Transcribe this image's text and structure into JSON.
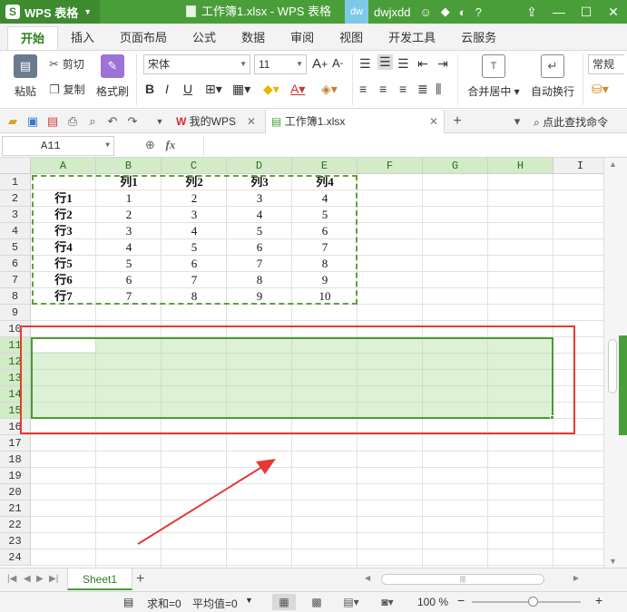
{
  "titlebar": {
    "app_name": "WPS 表格",
    "window_title": "工作簿1.xlsx - WPS 表格",
    "avatar_text": "dw",
    "username": "dwjxdd"
  },
  "ribbon_tabs": [
    "开始",
    "插入",
    "页面布局",
    "公式",
    "数据",
    "审阅",
    "视图",
    "开发工具",
    "云服务"
  ],
  "ribbon": {
    "paste": "粘贴",
    "cut": "剪切",
    "copy": "复制",
    "format_painter": "格式刷",
    "font_name": "宋体",
    "font_size": "11",
    "merge_center": "合并居中",
    "wrap_text": "自动换行",
    "number_format": "常规"
  },
  "doc_tabs": {
    "my_wps": "我的WPS",
    "workbook": "工作簿1.xlsx",
    "search_cmd": "点此查找命令"
  },
  "formula_bar": {
    "name_box": "A11",
    "fx": "fx"
  },
  "grid": {
    "columns": [
      "A",
      "B",
      "C",
      "D",
      "E",
      "F",
      "G",
      "H",
      "I"
    ],
    "rows": [
      "1",
      "2",
      "3",
      "4",
      "5",
      "6",
      "7",
      "8",
      "9",
      "10",
      "11",
      "12",
      "13",
      "14",
      "15",
      "16",
      "17",
      "18",
      "19",
      "20",
      "21",
      "22",
      "23",
      "24"
    ],
    "header_row": [
      "",
      "列1",
      "列2",
      "列3",
      "列4"
    ],
    "data_rows": [
      [
        "行1",
        "1",
        "2",
        "3",
        "4"
      ],
      [
        "行2",
        "2",
        "3",
        "4",
        "5"
      ],
      [
        "行3",
        "3",
        "4",
        "5",
        "6"
      ],
      [
        "行4",
        "4",
        "5",
        "6",
        "7"
      ],
      [
        "行5",
        "5",
        "6",
        "7",
        "8"
      ],
      [
        "行6",
        "6",
        "7",
        "8",
        "9"
      ],
      [
        "行7",
        "7",
        "8",
        "9",
        "10"
      ]
    ],
    "active_cell": "A11",
    "selected_range": "A11:H15",
    "copy_range": "A1:E8"
  },
  "sheets": [
    "Sheet1"
  ],
  "statusbar": {
    "sum": "求和=0",
    "average": "平均值=0",
    "zoom": "100 %"
  },
  "colors": {
    "brand_green": "#4a9e3a",
    "selection_fill": "#b4e1a0",
    "annotation_red": "#e53935"
  }
}
